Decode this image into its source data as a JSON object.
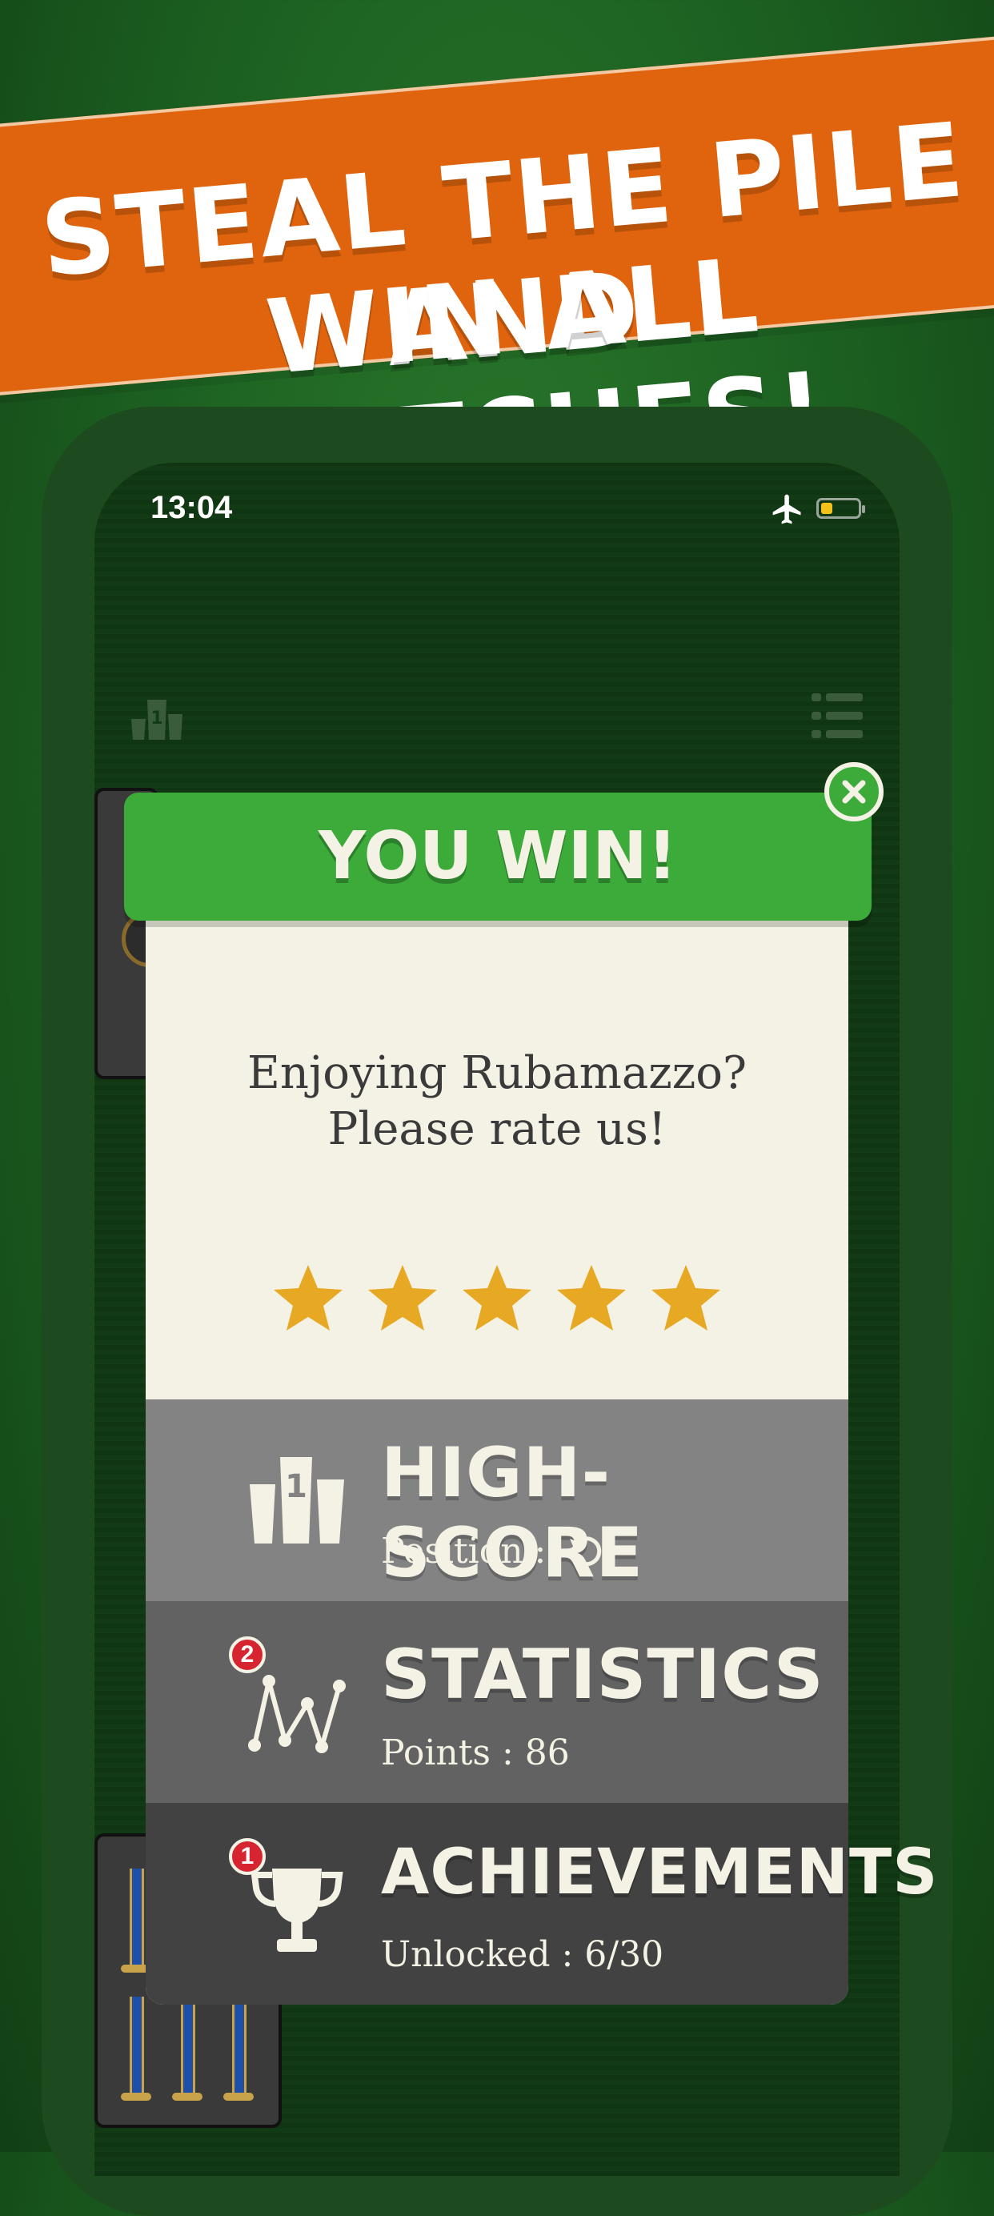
{
  "banner": {
    "line1": "STEAL THE PILE AND",
    "line2": "WIN ALL MATCHES!",
    "color": "#e0640e"
  },
  "status_bar": {
    "time": "13:04",
    "icons": [
      "airplane-icon",
      "battery-icon"
    ]
  },
  "top_bar": {
    "left_icon": "podium-icon",
    "right_icon": "menu-icon"
  },
  "modal": {
    "title": "YOU WIN!",
    "close_icon": "close-icon",
    "rate_line1": "Enjoying Rubamazzo?",
    "rate_line2": "Please rate us!",
    "stars_count": 5,
    "star_color": "#e7a823",
    "header_color": "#3cab3a"
  },
  "rows": {
    "highscore": {
      "title": "HIGH-SCORE",
      "subtitle": "Position :",
      "icon": "podium-icon",
      "status_icon": "refresh-icon"
    },
    "statistics": {
      "title": "STATISTICS",
      "subtitle": "Points : 86",
      "icon": "chart-icon",
      "badge": "2"
    },
    "achievements": {
      "title": "ACHIEVEMENTS",
      "subtitle": "Unlocked : 6/30",
      "icon": "trophy-icon",
      "badge": "1"
    }
  }
}
